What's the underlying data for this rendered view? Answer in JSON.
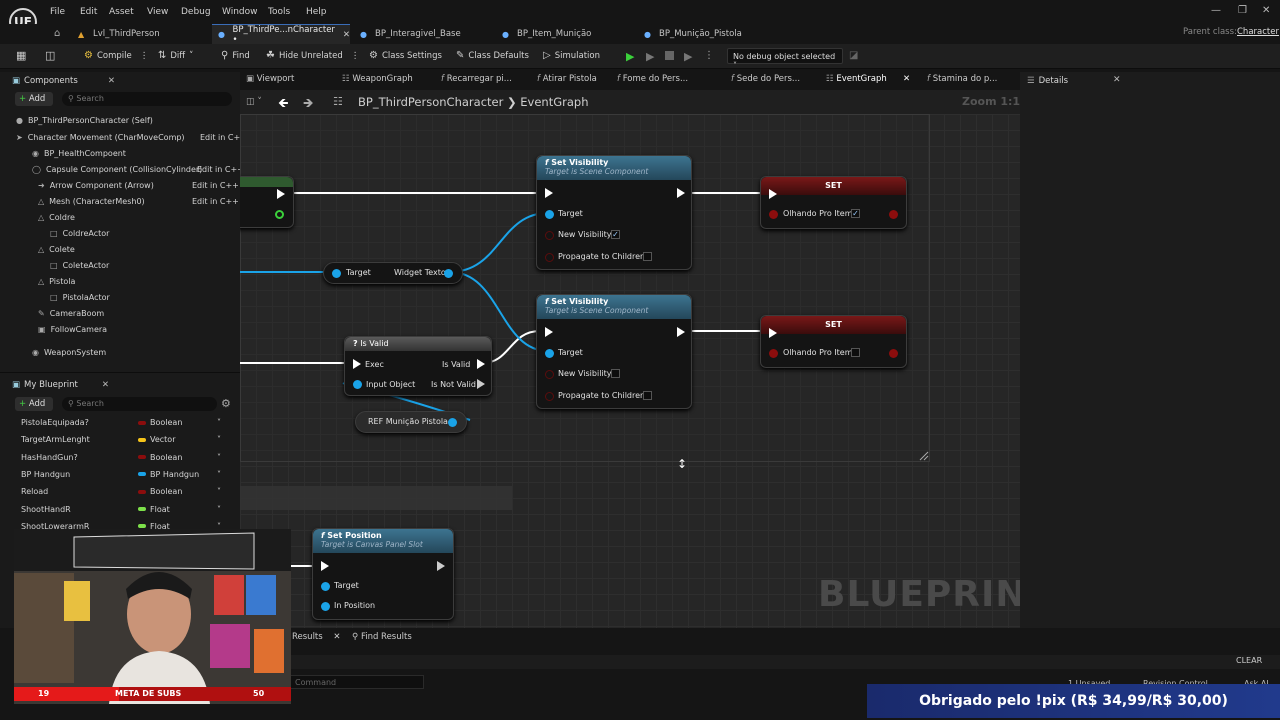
{
  "app": {
    "logo": "UE"
  },
  "menu": [
    "File",
    "Edit",
    "Asset",
    "View",
    "Debug",
    "Window",
    "Tools",
    "Help"
  ],
  "parent_class": {
    "label": "Parent class:",
    "value": "Character"
  },
  "doc_tabs": [
    {
      "label": "Lvl_ThirdPerson",
      "active": false
    },
    {
      "label": "BP_ThirdPe...nCharacter •",
      "active": true
    },
    {
      "label": "BP_Interagivel_Base",
      "active": false
    },
    {
      "label": "BP_Item_Munição",
      "active": false
    },
    {
      "label": "BP_Munição_Pistola",
      "active": false
    }
  ],
  "toolbar": {
    "compile": "Compile",
    "diff": "Diff",
    "find": "Find",
    "hide_unrelated": "Hide Unrelated",
    "class_settings": "Class Settings",
    "class_defaults": "Class Defaults",
    "simulation": "Simulation",
    "debug_select": "No debug object selected"
  },
  "components": {
    "title": "Components",
    "add": "Add",
    "search_placeholder": "Search",
    "items": [
      {
        "label": "BP_ThirdPersonCharacter (Self)",
        "edit": ""
      },
      {
        "label": "Character Movement (CharMoveComp)",
        "edit": "Edit in C+"
      },
      {
        "label": "BP_HealthCompoent",
        "edit": ""
      },
      {
        "label": "Capsule Component (CollisionCylinder)",
        "edit": "Edit in C++"
      },
      {
        "label": "Arrow Component (Arrow)",
        "edit": "Edit in C++"
      },
      {
        "label": "Mesh (CharacterMesh0)",
        "edit": "Edit in C++"
      },
      {
        "label": "Coldre",
        "edit": ""
      },
      {
        "label": "ColdreActor",
        "edit": ""
      },
      {
        "label": "Colete",
        "edit": ""
      },
      {
        "label": "ColeteActor",
        "edit": ""
      },
      {
        "label": "Pistola",
        "edit": ""
      },
      {
        "label": "PistolaActor",
        "edit": ""
      },
      {
        "label": "CameraBoom",
        "edit": ""
      },
      {
        "label": "FollowCamera",
        "edit": ""
      },
      {
        "label": "WeaponSystem",
        "edit": ""
      }
    ]
  },
  "my_blueprint": {
    "title": "My Blueprint",
    "add": "Add",
    "search_placeholder": "Search",
    "vars": [
      {
        "name": "PistolaEquipada?",
        "type": "Boolean",
        "color": "#8c0d0d"
      },
      {
        "name": "TargetArmLenght",
        "type": "Vector",
        "color": "#f7c51a"
      },
      {
        "name": "HasHandGun?",
        "type": "Boolean",
        "color": "#8c0d0d"
      },
      {
        "name": "BP Handgun",
        "type": "BP Handgun",
        "color": "#1aa3e8"
      },
      {
        "name": "Reload",
        "type": "Boolean",
        "color": "#8c0d0d"
      },
      {
        "name": "ShootHandR",
        "type": "Float",
        "color": "#7de04a"
      },
      {
        "name": "ShootLowerarmR",
        "type": "Float",
        "color": "#7de04a"
      }
    ]
  },
  "graph_tabs": [
    {
      "label": "Viewport",
      "active": false
    },
    {
      "label": "WeaponGraph",
      "active": false
    },
    {
      "label": "Recarregar pi...",
      "active": false
    },
    {
      "label": "Atirar Pistola",
      "active": false
    },
    {
      "label": "Fome do Pers...",
      "active": false
    },
    {
      "label": "Sede do Pers...",
      "active": false
    },
    {
      "label": "EventGraph",
      "active": true
    },
    {
      "label": "Stamina do p...",
      "active": false
    }
  ],
  "details": {
    "title": "Details"
  },
  "breadcrumb": {
    "bp": "BP_ThirdPersonCharacter",
    "sep": "❯",
    "graph": "EventGraph"
  },
  "zoom": "Zoom 1:1",
  "watermark": "BLUEPRINT",
  "nodes": {
    "setvis1": {
      "title": "Set Visibility",
      "sub": "Target is Scene Component",
      "target": "Target",
      "newvis": "New Visibility",
      "prop": "Propagate to Children",
      "checked": true
    },
    "setvis2": {
      "title": "Set Visibility",
      "sub": "Target is Scene Component",
      "target": "Target",
      "newvis": "New Visibility",
      "prop": "Propagate to Children",
      "checked": false
    },
    "set1": {
      "title": "SET",
      "var": "Olhando Pro Item",
      "checked": true
    },
    "set2": {
      "title": "SET",
      "var": "Olhando Pro Item",
      "checked": false
    },
    "widget": {
      "target": "Target",
      "out": "Widget Texto"
    },
    "isvalid": {
      "title": "Is Valid",
      "exec": "Exec",
      "input": "Input Object",
      "valid": "Is Valid",
      "notvalid": "Is Not Valid"
    },
    "ref": {
      "label": "REF Munição Pistola"
    },
    "setpos": {
      "title": "Set Position",
      "sub": "Target is Canvas Panel Slot",
      "target": "Target",
      "pos": "In Position"
    }
  },
  "bottom": {
    "tabs": [
      {
        "label": "Results"
      },
      {
        "label": "Find Results"
      }
    ],
    "clear": "CLEAR",
    "cmd_placeholder": "Command",
    "unsaved": "1 Unsaved",
    "revision": "Revision Control",
    "ask": "Ask AI"
  },
  "overlay": {
    "meta_label": "META DE SUBS",
    "meta_current": "19",
    "meta_target": "50",
    "meta_progress": 0.38,
    "pix": "Obrigado pelo !pix (R$ 34,99/R$ 30,00)"
  },
  "colors": {
    "accent": "#3a6db8",
    "exec_wire": "#ffffff",
    "object_wire": "#1aa3e8",
    "set_header": "#7a1818",
    "func_header": "#3a6f8c",
    "pix_bg": "#1a2a6c"
  }
}
